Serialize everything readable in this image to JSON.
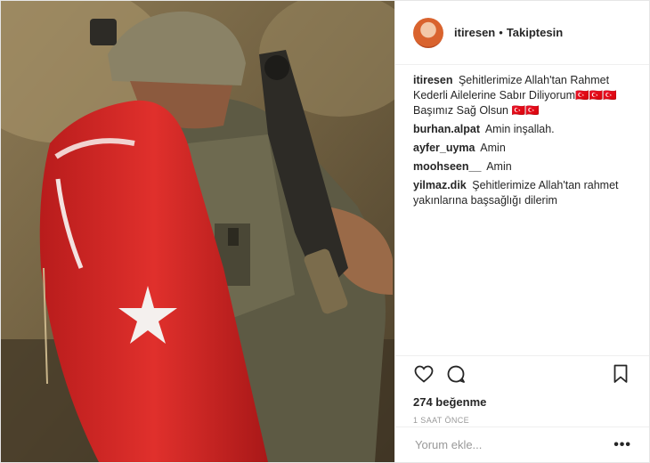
{
  "post": {
    "photo": {
      "icon": "soldier-with-turkish-flag-photo",
      "palette": {
        "ground": "#6b5a3c",
        "flag": "#d62a2a",
        "helmet": "#8a8266"
      }
    },
    "header": {
      "username": "itiresen",
      "separator": "•",
      "follow_status": "Takiptesin"
    },
    "caption": {
      "username": "itiresen",
      "text": "Şehitlerimize Allah'tan Rahmet Kederli Ailelerine Sabır Diliyorum🇹🇷🇹🇷🇹🇷 Başımız Sağ Olsun 🇹🇷🇹🇷"
    },
    "comments": [
      {
        "username": "burhan.alpat",
        "text": "Amin inşallah."
      },
      {
        "username": "ayfer_uyma",
        "text": "Amin"
      },
      {
        "username": "moohseen__",
        "text": "Amin"
      },
      {
        "username": "yilmaz.dik",
        "text": "Şehitlerimize Allah'tan rahmet yakınlarına başsağlığı dilerim"
      }
    ],
    "actions": {
      "like_icon": "heart-icon",
      "comment_icon": "comment-bubble-icon",
      "save_icon": "bookmark-icon"
    },
    "likes": "274 beğenme",
    "timestamp": "1 SAAT ÖNCE",
    "comment_input": {
      "placeholder": "Yorum ekle...",
      "value": ""
    },
    "more_label": "•••"
  }
}
